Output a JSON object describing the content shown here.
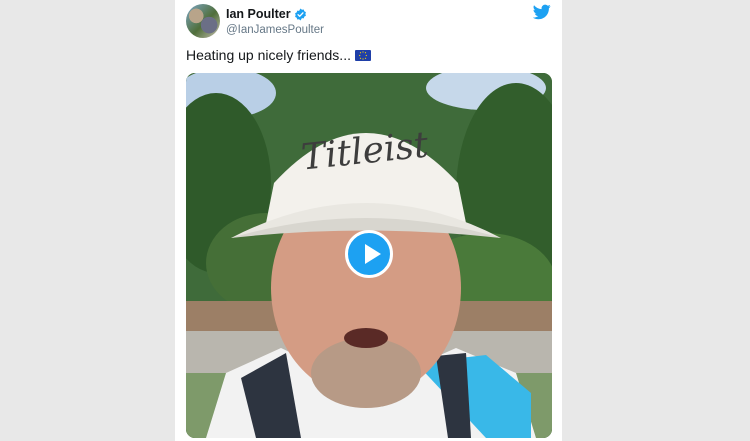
{
  "tweet": {
    "author": {
      "display_name": "Ian Poulter",
      "handle": "@IanJamesPoulter",
      "verified": true
    },
    "text": "Heating up nicely friends...",
    "emoji": "eu-flag",
    "media": {
      "type": "video",
      "visor_text": "Titleist",
      "play_icon": "play-icon"
    },
    "brand_icon": "twitter-bird-icon"
  },
  "colors": {
    "twitter_blue": "#1da1f2",
    "text_primary": "#14171a",
    "text_secondary": "#657786"
  }
}
